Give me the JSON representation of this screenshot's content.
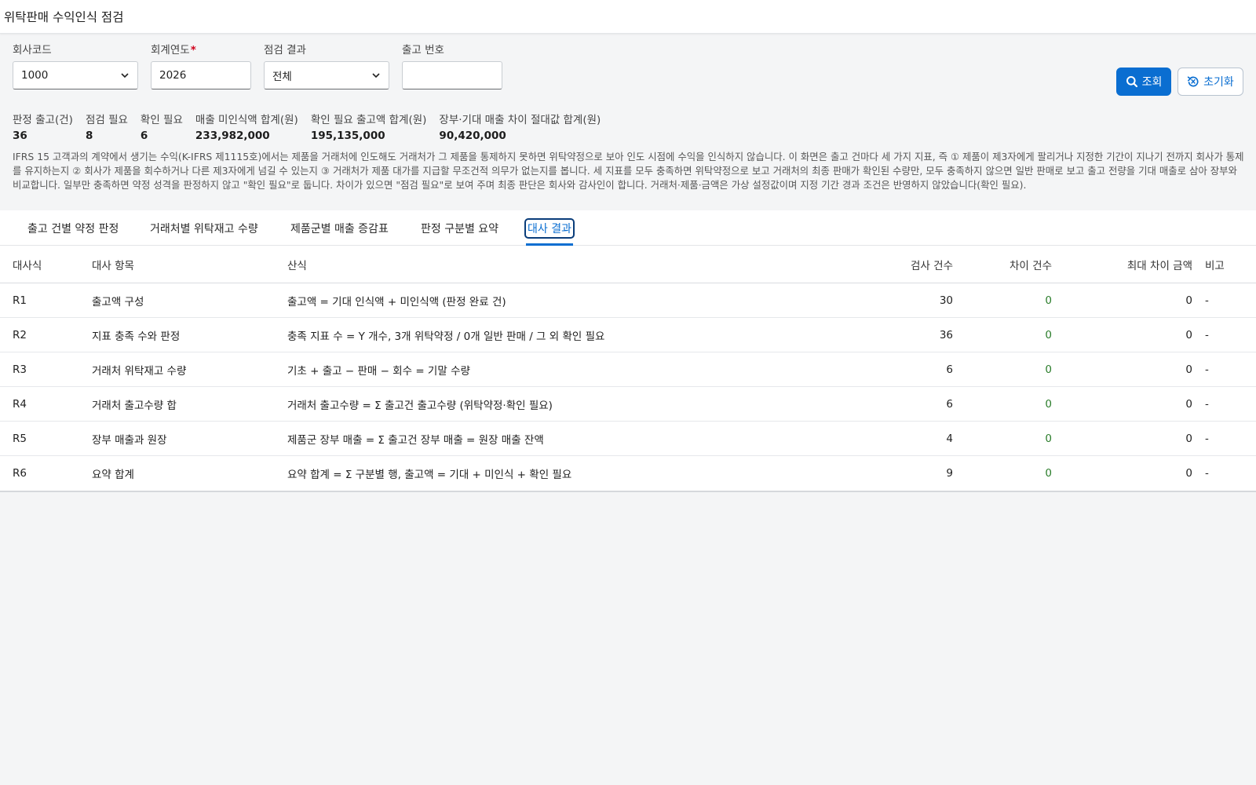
{
  "app": {
    "title": "위탁판매 수익인식 점검"
  },
  "filters": {
    "company_label": "회사코드",
    "company_value": "1000",
    "year_label": "회계연도",
    "year_required": "*",
    "year_value": "2026",
    "result_label": "점검 결과",
    "result_value": "전체",
    "delivery_label": "출고 번호",
    "delivery_value": ""
  },
  "buttons": {
    "search": "조회",
    "reset": "초기화"
  },
  "stats": [
    {
      "label": "판정 출고(건)",
      "value": "36"
    },
    {
      "label": "점검 필요",
      "value": "8"
    },
    {
      "label": "확인 필요",
      "value": "6"
    },
    {
      "label": "매출 미인식액 합계(원)",
      "value": "233,982,000"
    },
    {
      "label": "확인 필요 출고액 합계(원)",
      "value": "195,135,000"
    },
    {
      "label": "장부·기대 매출 차이 절대값 합계(원)",
      "value": "90,420,000"
    }
  ],
  "description": "IFRS 15 고객과의 계약에서 생기는 수익(K-IFRS 제1115호)에서는 제품을 거래처에 인도해도 거래처가 그 제품을 통제하지 못하면 위탁약정으로 보아 인도 시점에 수익을 인식하지 않습니다. 이 화면은 출고 건마다 세 가지 지표, 즉 ① 제품이 제3자에게 팔리거나 지정한 기간이 지나기 전까지 회사가 통제를 유지하는지 ② 회사가 제품을 회수하거나 다른 제3자에게 넘길 수 있는지 ③ 거래처가 제품 대가를 지급할 무조건적 의무가 없는지를 봅니다. 세 지표를 모두 충족하면 위탁약정으로 보고 거래처의 최종 판매가 확인된 수량만, 모두 충족하지 않으면 일반 판매로 보고 출고 전량을 기대 매출로 삼아 장부와 비교합니다. 일부만 충족하면 약정 성격을 판정하지 않고 \"확인 필요\"로 둡니다. 차이가 있으면 \"점검 필요\"로 보여 주며 최종 판단은 회사와 감사인이 합니다. 거래처·제품·금액은 가상 설정값이며 지정 기간 경과 조건은 반영하지 않았습니다(확인 필요).",
  "tabs": [
    {
      "label": "출고 건별 약정 판정"
    },
    {
      "label": "거래처별 위탁재고 수량"
    },
    {
      "label": "제품군별 매출 증감표"
    },
    {
      "label": "판정 구분별 요약"
    },
    {
      "label": "대사 결과",
      "active": true
    }
  ],
  "table": {
    "headers": {
      "id": "대사식",
      "item": "대사 항목",
      "formula": "산식",
      "count": "검사 건수",
      "diff": "차이 건수",
      "max": "최대 차이 금액",
      "note": "비고"
    },
    "rows": [
      {
        "id": "R1",
        "item": "출고액 구성",
        "formula": "출고액 = 기대 인식액 + 미인식액 (판정 완료 건)",
        "count": "30",
        "diff": "0",
        "max": "0",
        "note": "-"
      },
      {
        "id": "R2",
        "item": "지표 충족 수와 판정",
        "formula": "충족 지표 수 = Y 개수, 3개 위탁약정 / 0개 일반 판매 / 그 외 확인 필요",
        "count": "36",
        "diff": "0",
        "max": "0",
        "note": "-"
      },
      {
        "id": "R3",
        "item": "거래처 위탁재고 수량",
        "formula": "기초 + 출고 − 판매 − 회수 = 기말 수량",
        "count": "6",
        "diff": "0",
        "max": "0",
        "note": "-"
      },
      {
        "id": "R4",
        "item": "거래처 출고수량 합",
        "formula": "거래처 출고수량 = Σ 출고건 출고수량 (위탁약정·확인 필요)",
        "count": "6",
        "diff": "0",
        "max": "0",
        "note": "-"
      },
      {
        "id": "R5",
        "item": "장부 매출과 원장",
        "formula": "제품군 장부 매출 = Σ 출고건 장부 매출 = 원장 매출 잔액",
        "count": "4",
        "diff": "0",
        "max": "0",
        "note": "-"
      },
      {
        "id": "R6",
        "item": "요약 합계",
        "formula": "요약 합계 = Σ 구분별 행, 출고액 = 기대 + 미인식 + 확인 필요",
        "count": "9",
        "diff": "0",
        "max": "0",
        "note": "-"
      }
    ]
  },
  "colors": {
    "accent": "#0a6ed1",
    "diff_zero": "#2b7d2b"
  },
  "icons": {
    "dropdown": "chevron-down-icon",
    "search": "search-icon",
    "reset": "reset-icon"
  }
}
